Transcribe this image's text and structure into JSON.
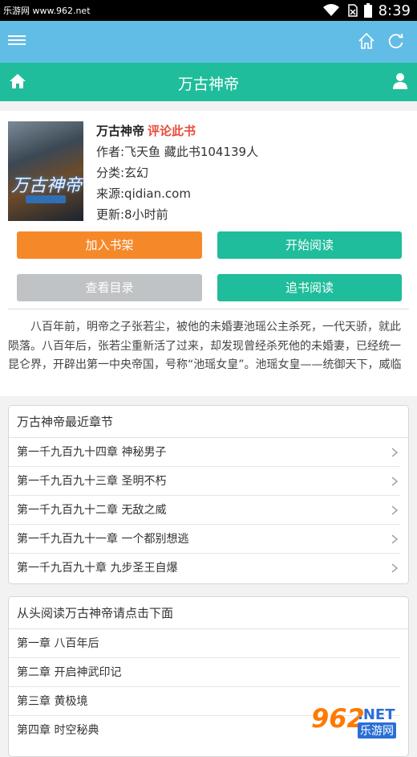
{
  "status_bar": {
    "watermark": "乐游网 www.962.net",
    "time": "8:39"
  },
  "top_bar": {
    "menu_icon": "menu-icon",
    "home_icon": "home-outline-icon",
    "refresh_icon": "refresh-icon"
  },
  "title_bar": {
    "title": "万古神帝",
    "home_icon": "home-icon",
    "user_icon": "user-icon"
  },
  "book": {
    "title": "万古神帝",
    "review_link": "评论此书",
    "author": "作者:飞天鱼 藏此书104139人",
    "category": "分类:玄幻",
    "source": "来源:qidian.com",
    "updated": "更新:8小时前",
    "cover_text": "万古神帝"
  },
  "actions": {
    "add_shelf": "加入书架",
    "start_reading": "开始阅读",
    "view_catalog": "查看目录",
    "follow_reading": "追书阅读"
  },
  "description": "八百年前，明帝之子张若尘，被他的未婚妻池瑶公主杀死，一代天骄，就此陨落。八百年后，张若尘重新活了过来，却发现曾经杀死他的未婚妻，已经统一昆仑界，开辟出第一中央帝国，号称“池瑶女皇”。池瑶女皇——统御天下，威临八方；青春永驻，不死不灭。张若尘站在诸皇祠堂外，望着池瑶女皇的神像，心中燃烧起熊...",
  "latest": {
    "heading": "万古神帝最近章节",
    "chapters": [
      "第一千九百九十四章 神秘男子",
      "第一千九百九十三章 圣明不朽",
      "第一千九百九十二章 无敌之威",
      "第一千九百九十一章 一个都别想逃",
      "第一千九百九十章 九步圣王自爆"
    ]
  },
  "from_start": {
    "heading": "从头阅读万古神帝请点击下面",
    "chapters": [
      "第一章 八百年后",
      "第二章 开启神武印记",
      "第三章 黄极境",
      "第四章 时空秘典"
    ]
  },
  "watermark_logo": {
    "number": "962",
    "net": ".NET",
    "site": "乐游网"
  },
  "colors": {
    "top_bar": "#62bde6",
    "title_bar": "#1fbd9b",
    "orange": "#f5892a",
    "green": "#1fbd9b",
    "gray": "#bfc3c6",
    "review": "#e74c3c"
  }
}
